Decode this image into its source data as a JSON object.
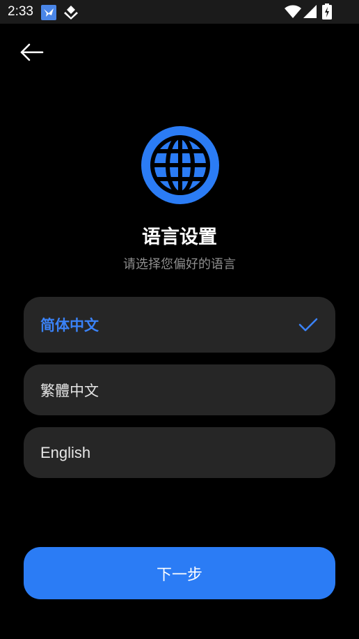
{
  "status_bar": {
    "time": "2:33",
    "icons": [
      "app-notification-icon",
      "app-diamond-icon",
      "wifi-icon",
      "cell-signal-icon",
      "battery-charging-icon"
    ]
  },
  "navigation": {
    "back_icon": "arrow-left-icon"
  },
  "header": {
    "icon": "globe-icon",
    "title": "语言设置",
    "subtitle": "请选择您偏好的语言"
  },
  "languages": [
    {
      "label": "简体中文",
      "selected": true
    },
    {
      "label": "繁體中文",
      "selected": false
    },
    {
      "label": "English",
      "selected": false
    }
  ],
  "footer": {
    "next_label": "下一步"
  },
  "colors": {
    "background": "#000000",
    "status_bar": "#1b1b1b",
    "accent": "#2b7cf5",
    "option_background": "#262626",
    "subtitle_text": "#8e8e8e"
  }
}
